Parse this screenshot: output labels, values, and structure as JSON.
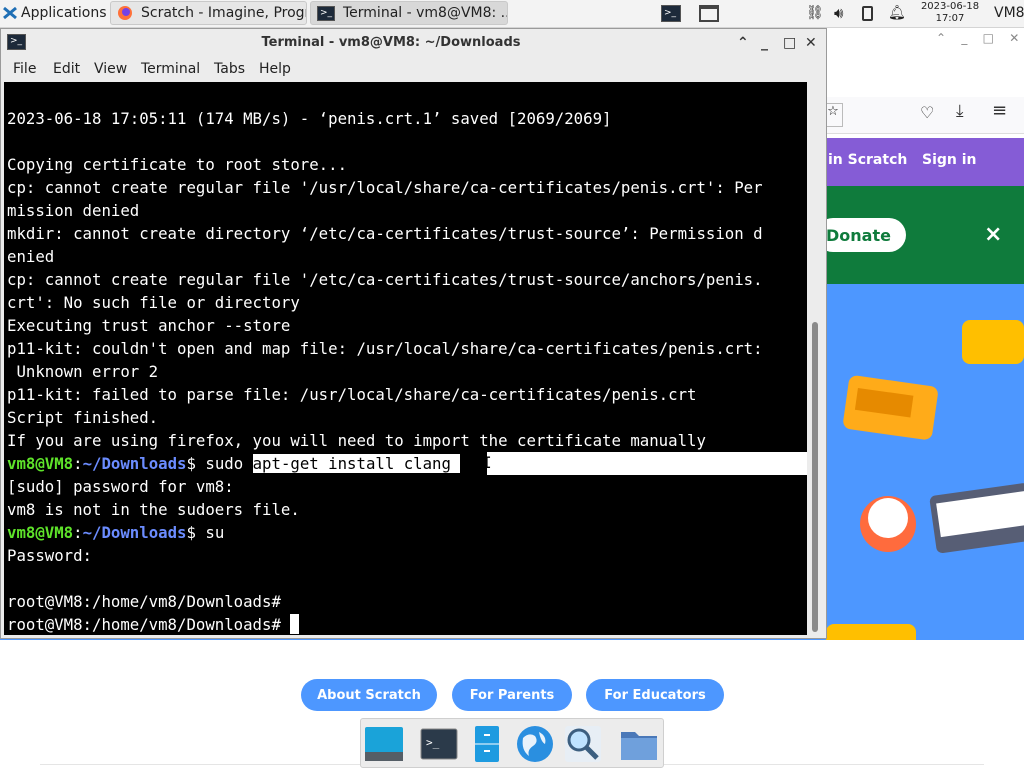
{
  "panel": {
    "applications_label": "Applications",
    "tasks": [
      {
        "label": "Scratch - Imagine, Progr..."
      },
      {
        "label": "Terminal - vm8@VM8: ..."
      }
    ],
    "clock_date": "2023-06-18",
    "clock_time": "17:07",
    "user": "VM8"
  },
  "terminal": {
    "title": "Terminal - vm8@VM8: ~/Downloads",
    "menu": [
      "File",
      "Edit",
      "View",
      "Terminal",
      "Tabs",
      "Help"
    ],
    "lines": [
      "2023-06-18 17:05:11 (174 MB/s) - ‘penis.crt.1’ saved [2069/2069]",
      "",
      "Copying certificate to root store...",
      "cp: cannot create regular file '/usr/local/share/ca-certificates/penis.crt': Per",
      "mission denied",
      "mkdir: cannot create directory ‘/etc/ca-certificates/trust-source’: Permission d",
      "enied",
      "cp: cannot create regular file '/etc/ca-certificates/trust-source/anchors/penis.",
      "crt': No such file or directory",
      "Executing trust anchor --store",
      "p11-kit: couldn't open and map file: /usr/local/share/ca-certificates/penis.crt:",
      " Unknown error 2",
      "p11-kit: failed to parse file: /usr/local/share/ca-certificates/penis.crt",
      "Script finished.",
      "If you are using firefox, you will need to import the certificate manually"
    ],
    "prompt_user": "vm8@VM8",
    "prompt_sep": ":",
    "prompt_dir": "~/Downloads",
    "prompt_end": "$ ",
    "cmd1_prefix": "sudo ",
    "cmd1_selected": "apt-get install clang ",
    "after1": [
      "[sudo] password for vm8:",
      "vm8 is not in the sudoers file."
    ],
    "cmd2": "su",
    "after2": [
      "Password:",
      ""
    ],
    "root_prompt_1": "root@VM8:/home/vm8/Downloads#",
    "root_prompt_2": "root@VM8:/home/vm8/Downloads# "
  },
  "browser": {
    "join": "in Scratch",
    "sign_in": "Sign in",
    "donate": "Donate",
    "close": "×",
    "footer_buttons": [
      "About Scratch",
      "For Parents",
      "For Educators"
    ]
  },
  "colors": {
    "scratch_blue": "#4d97ff",
    "scratch_purple": "#855cd6",
    "donate_green": "#0f7b3c",
    "prompt_green": "#5ee32a",
    "prompt_blue": "#6b8cff"
  }
}
